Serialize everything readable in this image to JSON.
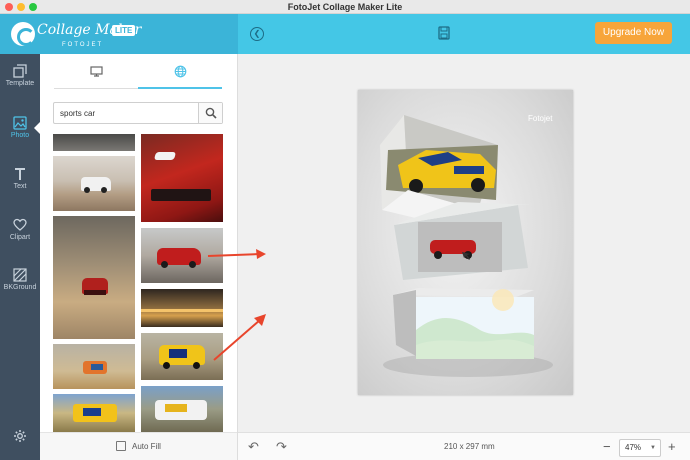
{
  "window": {
    "title": "FotoJet Collage Maker Lite"
  },
  "brand": {
    "name": "Collage Maker",
    "edition": "LITE",
    "sub": "FOTOJET"
  },
  "header": {
    "upgrade_label": "Upgrade Now"
  },
  "nav": {
    "items": [
      {
        "label": "Template",
        "icon": "template-icon"
      },
      {
        "label": "Photo",
        "icon": "photo-icon"
      },
      {
        "label": "Text",
        "icon": "text-icon"
      },
      {
        "label": "Clipart",
        "icon": "heart-icon"
      },
      {
        "label": "BKGround",
        "icon": "background-icon"
      }
    ],
    "active": "Photo"
  },
  "photo_panel": {
    "search": {
      "value": "sports car"
    },
    "auto_fill_label": "Auto Fill"
  },
  "canvas": {
    "watermark": "Fotojet"
  },
  "bottombar": {
    "page_size": "210 x 297 mm",
    "zoom": "47%"
  },
  "colors": {
    "accent": "#4fc3e8",
    "header": "#44c7e6",
    "upgrade": "#f7a53a",
    "nav_bg": "#3f4f60",
    "arrow": "#e8452c"
  }
}
